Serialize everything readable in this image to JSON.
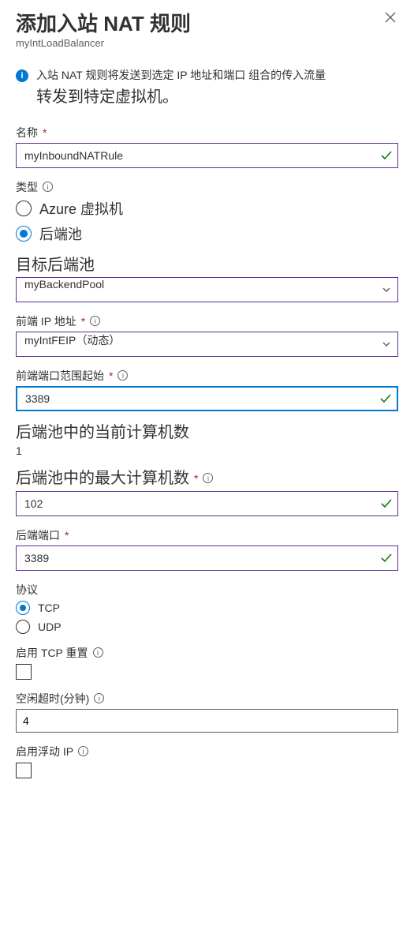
{
  "header": {
    "title": "添加入站 NAT 规则",
    "subtitle": "myIntLoadBalancer"
  },
  "info": {
    "line1": "入站 NAT 规则将发送到选定 IP 地址和端口 组合的传入流量",
    "line2": "转发到特定虚拟机。"
  },
  "fields": {
    "name": {
      "label": "名称",
      "value": "myInboundNATRule"
    },
    "type": {
      "label": "类型",
      "options": {
        "azure_vm": "Azure 虚拟机",
        "backend_pool": "后端池"
      },
      "selected": "backend_pool"
    },
    "target_pool": {
      "label": "目标后端池",
      "value": "myBackendPool"
    },
    "frontend_ip": {
      "label": "前端 IP 地址",
      "value": "myIntFEIP（动态）"
    },
    "port_start": {
      "label": "前端端口范围起始",
      "value": "3389"
    },
    "current_machines": {
      "label": "后端池中的当前计算机数",
      "value": "1"
    },
    "max_machines": {
      "label": "后端池中的最大计算机数",
      "value": "102"
    },
    "backend_port": {
      "label": "后端端口",
      "value": "3389"
    },
    "protocol": {
      "label": "协议",
      "options": {
        "tcp": "TCP",
        "udp": "UDP"
      },
      "selected": "tcp"
    },
    "tcp_reset": {
      "label": "启用 TCP 重置"
    },
    "idle_timeout": {
      "label": "空闲超时(分钟)",
      "value": "4"
    },
    "floating_ip": {
      "label": "启用浮动 IP"
    }
  },
  "glyphs": {
    "asterisk": "*"
  }
}
